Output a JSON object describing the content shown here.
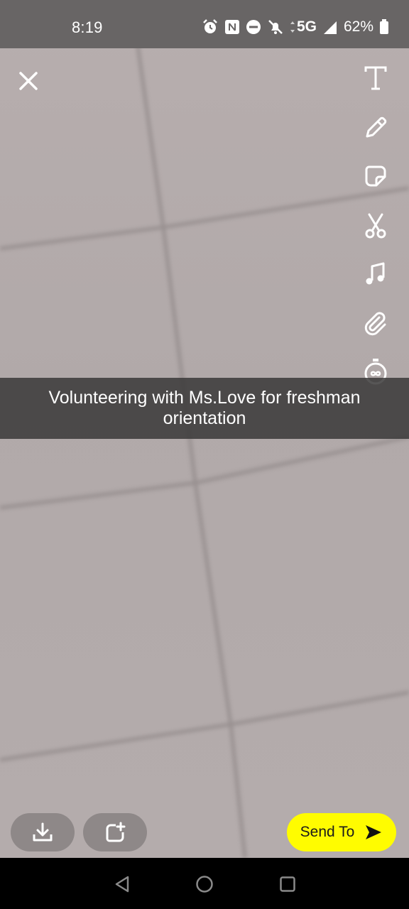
{
  "status_bar": {
    "time": "8:19",
    "network": "5G",
    "battery": "62%",
    "icons": [
      "alarm-icon",
      "nfc-icon",
      "do-not-disturb-icon",
      "bell-muted-icon",
      "signal-icon",
      "battery-icon"
    ]
  },
  "editor": {
    "close_icon": "close-icon",
    "tools": [
      "text-tool-icon",
      "pencil-icon",
      "sticker-icon",
      "scissors-icon",
      "music-note-icon",
      "paperclip-icon",
      "timer-icon"
    ],
    "caption": "Volunteering with Ms.Love for freshman orientation"
  },
  "bottom_actions": {
    "save_icon": "download-icon",
    "story_icon": "add-story-icon",
    "send_label": "Send To",
    "send_color": "#fffc00"
  },
  "nav_bar": {
    "buttons": [
      "back-icon",
      "home-icon",
      "recents-icon"
    ]
  }
}
